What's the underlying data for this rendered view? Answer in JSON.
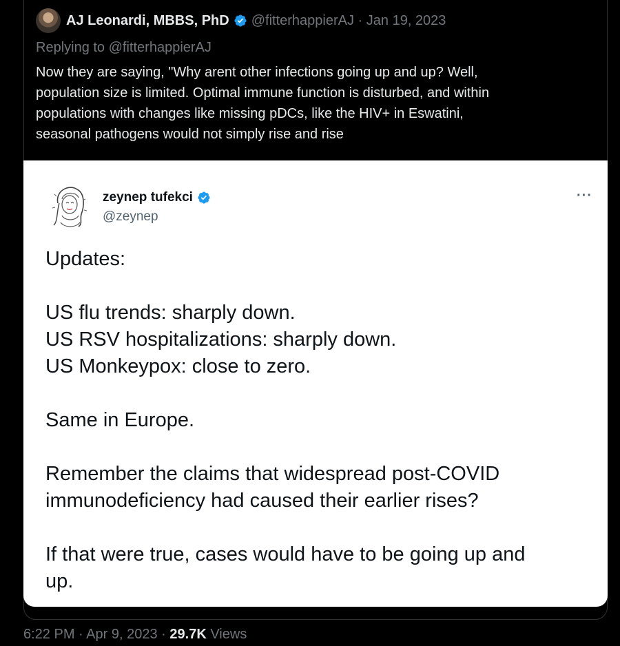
{
  "quoted_tweet": {
    "author_name": "AJ Leonardi, MBBS, PhD",
    "handle": "@fitterhappierAJ",
    "separator": "·",
    "date": "Jan 19, 2023",
    "replying_prefix": "Replying to",
    "replying_handle": "@fitterhappierAJ",
    "body_lines": [
      "Now they are saying, \"Why arent other infections going up and up? Well,",
      "population size is limited. Optimal immune function is disturbed, and within",
      "populations with changes like missing pDCs, like the HIV+ in Eswatini,",
      "seasonal pathogens would not simply rise and rise"
    ]
  },
  "embedded_card": {
    "author_name": "zeynep tufekci",
    "handle": "@zeynep",
    "more_label": "···",
    "paragraphs": [
      [
        "Updates:"
      ],
      [
        "US flu trends: sharply down.",
        "US RSV hospitalizations: sharply down.",
        "US Monkeypox: close to zero."
      ],
      [
        "Same in Europe."
      ],
      [
        "Remember the claims that widespread post-COVID",
        "immunodeficiency had caused their earlier rises?"
      ],
      [
        "If that were true, cases would have to be going up and",
        "up."
      ]
    ]
  },
  "footer": {
    "time": "6:22 PM",
    "separator": "·",
    "date": "Apr 9, 2023",
    "views_count": "29.7K",
    "views_label": "Views"
  },
  "colors": {
    "background": "#000000",
    "verified_blue": "#1d9bf0",
    "muted_text": "#71767b",
    "primary_text": "#e7e9ea"
  }
}
